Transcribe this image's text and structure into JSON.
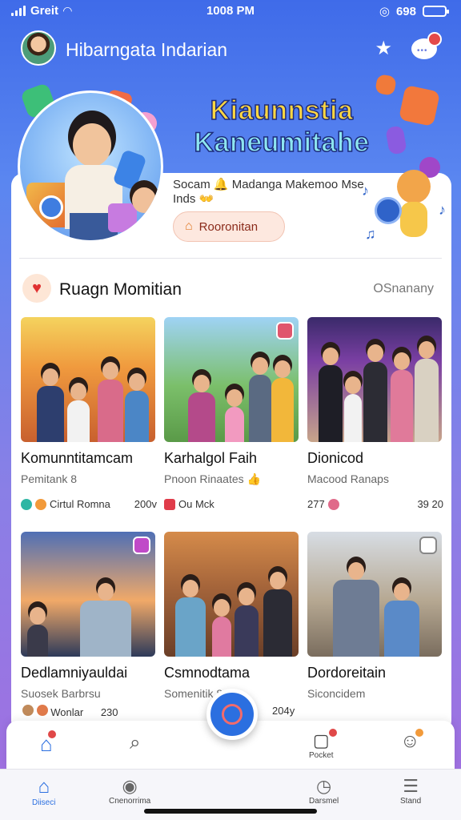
{
  "status": {
    "carrier": "Greit",
    "time": "1008 PM",
    "battery_label": "698"
  },
  "header": {
    "title": "Hibarngata Indarian"
  },
  "banner": {
    "title_line1": "Kiaunnstia",
    "title_line2": "Kaneumitahe",
    "subtitle": "Socam 🔔 Madanga Makemoo Mse Inds 👐",
    "button_label": "Rooronitan"
  },
  "section": {
    "title": "Ruagn Momitian",
    "link": "OSnanany"
  },
  "cards": [
    {
      "title": "Komunntitamcam",
      "subtitle": "Pemitank 8",
      "meta_left": "Cirtul Romna",
      "meta_right": "200v"
    },
    {
      "title": "Karhalgol Faih",
      "subtitle": "Pnoon Rinaates 👍",
      "meta_left": "Ou Mck",
      "meta_right": ""
    },
    {
      "title": "Dionicod",
      "subtitle": "Macood Ranaps",
      "meta_left": "277",
      "meta_right": "39 20"
    },
    {
      "title": "Dedlamniyauldai",
      "subtitle": "Suosek Barbrsu",
      "meta_left": "Wonlar",
      "meta_right": "230"
    },
    {
      "title": "Csmnodtama",
      "subtitle": "Somenitik 8",
      "meta_left": "",
      "meta_right": "204y"
    },
    {
      "title": "Dordoreitain",
      "subtitle": "Siconcidem",
      "meta_left": "",
      "meta_right": ""
    }
  ],
  "nav_top": {
    "home_badge": "",
    "friends_label": "Pocket",
    "friends_badge": "",
    "profile_badge": ""
  },
  "nav_bottom": [
    {
      "label": "Diiseci"
    },
    {
      "label": "Cnenorrima"
    },
    {
      "label": "Darsmel"
    },
    {
      "label": "Stand"
    }
  ],
  "colors": {
    "accent": "#2b6fe0",
    "banner_yellow": "#ffd742",
    "banner_cyan": "#8ee6f0"
  }
}
